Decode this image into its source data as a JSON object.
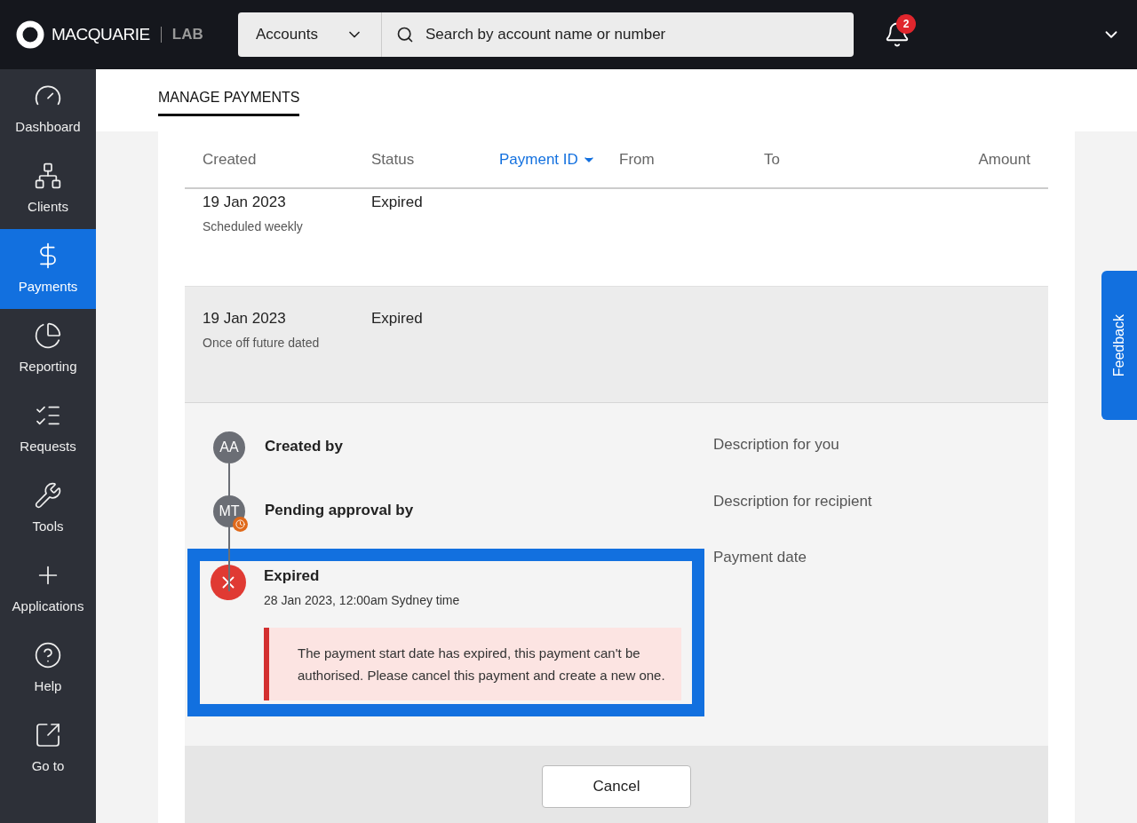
{
  "header": {
    "logo_text": "MACQUARIE",
    "logo_suffix": "LAB",
    "search_scope": "Accounts",
    "search": {
      "placeholder": "Search by account name or number"
    },
    "notification_count": "2"
  },
  "sidebar": {
    "items": [
      {
        "label": "Dashboard",
        "selected": false
      },
      {
        "label": "Clients",
        "selected": false
      },
      {
        "label": "Payments",
        "selected": true
      },
      {
        "label": "Reporting",
        "selected": false
      },
      {
        "label": "Requests",
        "selected": false
      },
      {
        "label": "Tools",
        "selected": false
      },
      {
        "label": "Applications",
        "selected": false
      },
      {
        "label": "Help",
        "selected": false
      },
      {
        "label": "Go to",
        "selected": false
      }
    ]
  },
  "page_tab": "MANAGE PAYMENTS",
  "table": {
    "columns": [
      {
        "label": "Created",
        "sorted": false
      },
      {
        "label": "Status",
        "sorted": false
      },
      {
        "label": "Payment ID",
        "sorted": true
      },
      {
        "label": "From",
        "sorted": false
      },
      {
        "label": "To",
        "sorted": false
      },
      {
        "label": "Amount",
        "sorted": false
      }
    ],
    "rows": [
      {
        "date": "19 Jan 2023",
        "schedule": "Scheduled weekly",
        "status": "Expired",
        "selected": false
      },
      {
        "date": "19 Jan 2023",
        "schedule": "Once off future dated",
        "status": "Expired",
        "selected": true
      }
    ]
  },
  "details": {
    "timeline": [
      {
        "kind": "person",
        "initials": "AA",
        "label": "Created by",
        "pending": false
      },
      {
        "kind": "person",
        "initials": "MT",
        "label": "Pending approval by",
        "pending": true
      },
      {
        "kind": "expired",
        "label": "Expired",
        "time": "28 Jan 2023, 12:00am Sydney time",
        "message": "The payment start date has expired, this payment can't be authorised. Please cancel this payment and create a new one."
      }
    ],
    "fields": [
      "Description for you",
      "Description for recipient",
      "Payment date"
    ]
  },
  "cancel_button": "Cancel",
  "feedback_tab": "Feedback"
}
